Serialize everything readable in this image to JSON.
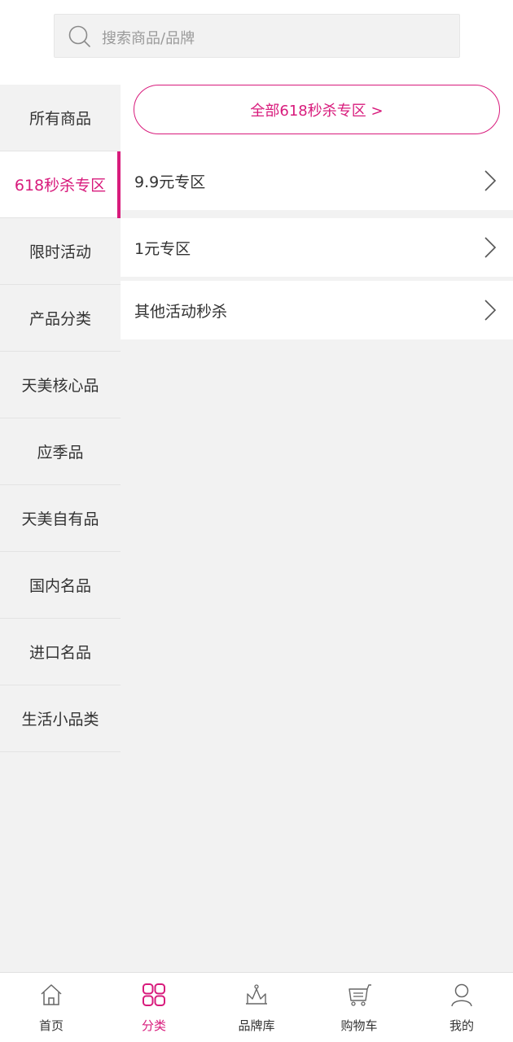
{
  "search": {
    "placeholder": "搜索商品/品牌"
  },
  "sidebar": {
    "items": [
      {
        "label": "所有商品"
      },
      {
        "label": "618秒杀专区"
      },
      {
        "label": "限时活动"
      },
      {
        "label": "产品分类"
      },
      {
        "label": "天美核心品"
      },
      {
        "label": "应季品"
      },
      {
        "label": "天美自有品"
      },
      {
        "label": "国内名品"
      },
      {
        "label": "进口名品"
      },
      {
        "label": "生活小品类"
      }
    ],
    "active_index": 1
  },
  "content": {
    "all_button": "全部618秒杀专区 >",
    "rows": [
      {
        "label": "9.9元专区"
      },
      {
        "label": "1元专区"
      },
      {
        "label": "其他活动秒杀"
      }
    ]
  },
  "tabbar": {
    "tabs": [
      {
        "label": "首页",
        "icon": "home-icon"
      },
      {
        "label": "分类",
        "icon": "grid-icon"
      },
      {
        "label": "品牌库",
        "icon": "crown-icon"
      },
      {
        "label": "购物车",
        "icon": "cart-icon"
      },
      {
        "label": "我的",
        "icon": "user-icon"
      }
    ],
    "active_index": 1
  },
  "colors": {
    "accent": "#d81b7c",
    "background": "#f2f2f2",
    "text": "#333333"
  }
}
